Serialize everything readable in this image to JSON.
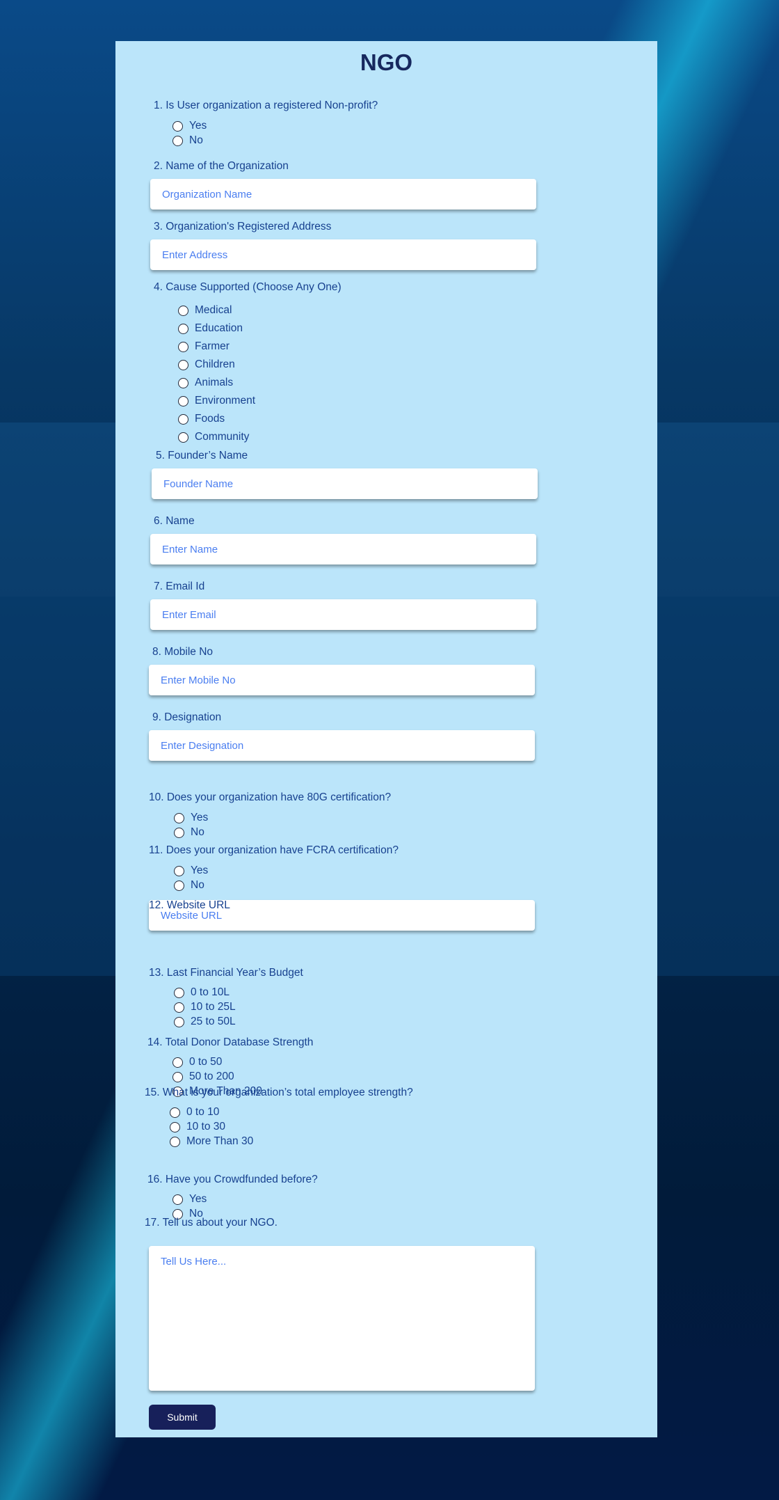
{
  "form": {
    "title": "NGO",
    "q1": {
      "label": "1. Is User organization a registered Non-profit?",
      "options": [
        "Yes",
        "No"
      ]
    },
    "q2": {
      "label": "2.  Name of the Organization",
      "placeholder": "Organization Name"
    },
    "q3": {
      "label": "3. Organization's Registered Address",
      "placeholder": "Enter Address"
    },
    "q4": {
      "label": "4. Cause Supported (Choose Any One)",
      "options": [
        "Medical",
        "Education",
        "Farmer",
        "Children",
        "Animals",
        "Environment",
        "Foods",
        "Community"
      ]
    },
    "q5": {
      "label": "5. Founder’s Name",
      "placeholder": "Founder Name"
    },
    "q6": {
      "label": "6. Name",
      "placeholder": "Enter Name"
    },
    "q7": {
      "label": "7. Email Id",
      "placeholder": "Enter Email"
    },
    "q8": {
      "label": "8. Mobile No",
      "placeholder": "Enter Mobile No"
    },
    "q9": {
      "label": "9. Designation",
      "placeholder": "Enter Designation"
    },
    "q10": {
      "label": "10. Does your organization have 80G certification?",
      "options": [
        "Yes",
        "No"
      ]
    },
    "q11": {
      "label": "11. Does your organization have FCRA certification?",
      "options": [
        "Yes",
        "No"
      ]
    },
    "q12": {
      "label": "12. Website URL",
      "placeholder": "Website URL"
    },
    "q13": {
      "label": "13. Last Financial Year’s Budget",
      "options": [
        "0 to 10L",
        "10 to 25L",
        "25 to 50L"
      ]
    },
    "q14": {
      "label": "14. Total Donor Database Strength",
      "options": [
        "0 to 50",
        "50 to 200",
        "More Than 200"
      ]
    },
    "q15": {
      "label": "15. What is your organization’s total employee strength?",
      "options": [
        "0 to 10",
        "10 to 30",
        "More Than 30"
      ]
    },
    "q16": {
      "label": "16. Have you Crowdfunded before?",
      "options": [
        "Yes",
        "No"
      ]
    },
    "q17": {
      "label": "17. Tell us about your NGO.",
      "placeholder": "Tell Us Here..."
    },
    "submit_label": "Submit"
  },
  "colors": {
    "card_bg": "#bbe5fa",
    "text": "#17418f",
    "title": "#17285e",
    "button": "#17205a"
  }
}
